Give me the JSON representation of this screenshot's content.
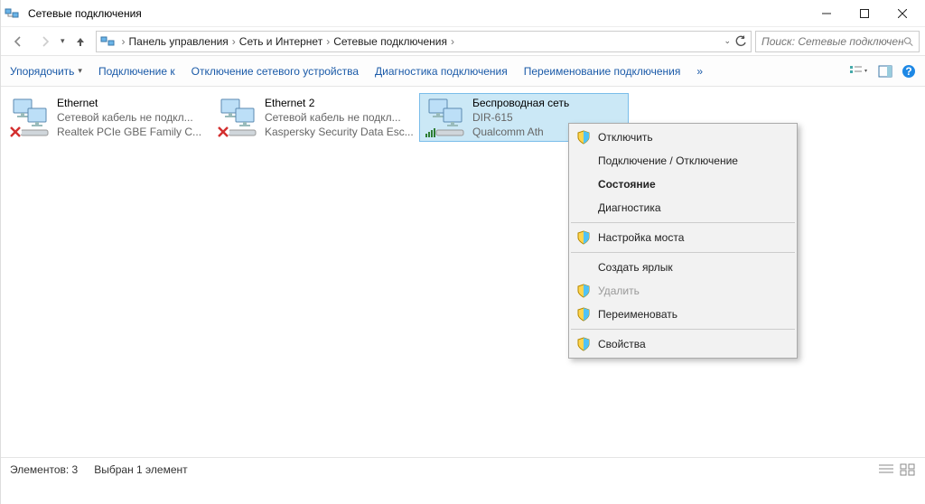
{
  "window": {
    "title": "Сетевые подключения"
  },
  "breadcrumb": {
    "root": "Панель управления",
    "cat": "Сеть и Интернет",
    "leaf": "Сетевые подключения"
  },
  "search": {
    "placeholder": "Поиск: Сетевые подключения"
  },
  "toolbar": {
    "organize": "Упорядочить",
    "connect": "Подключение к",
    "disable": "Отключение сетевого устройства",
    "diagnose": "Диагностика подключения",
    "rename": "Переименование подключения",
    "overflow": "»"
  },
  "connections": [
    {
      "name": "Ethernet",
      "status": "Сетевой кабель не подкл...",
      "device": "Realtek PCIe GBE Family C...",
      "disconnected": true
    },
    {
      "name": "Ethernet 2",
      "status": "Сетевой кабель не подкл...",
      "device": "Kaspersky Security Data Esc...",
      "disconnected": true
    },
    {
      "name": "Беспроводная сеть",
      "status": "DIR-615",
      "device": "Qualcomm Ath",
      "wireless": true,
      "selected": true
    }
  ],
  "context_menu": [
    {
      "label": "Отключить",
      "shield": true
    },
    {
      "label": "Подключение / Отключение"
    },
    {
      "label": "Состояние",
      "bold": true
    },
    {
      "label": "Диагностика"
    },
    {
      "sep": true
    },
    {
      "label": "Настройка моста",
      "shield": true
    },
    {
      "sep": true
    },
    {
      "label": "Создать ярлык"
    },
    {
      "label": "Удалить",
      "shield": true,
      "disabled": true
    },
    {
      "label": "Переименовать",
      "shield": true
    },
    {
      "sep": true
    },
    {
      "label": "Свойства",
      "shield": true
    }
  ],
  "statusbar": {
    "count": "Элементов: 3",
    "selected": "Выбран 1 элемент"
  }
}
